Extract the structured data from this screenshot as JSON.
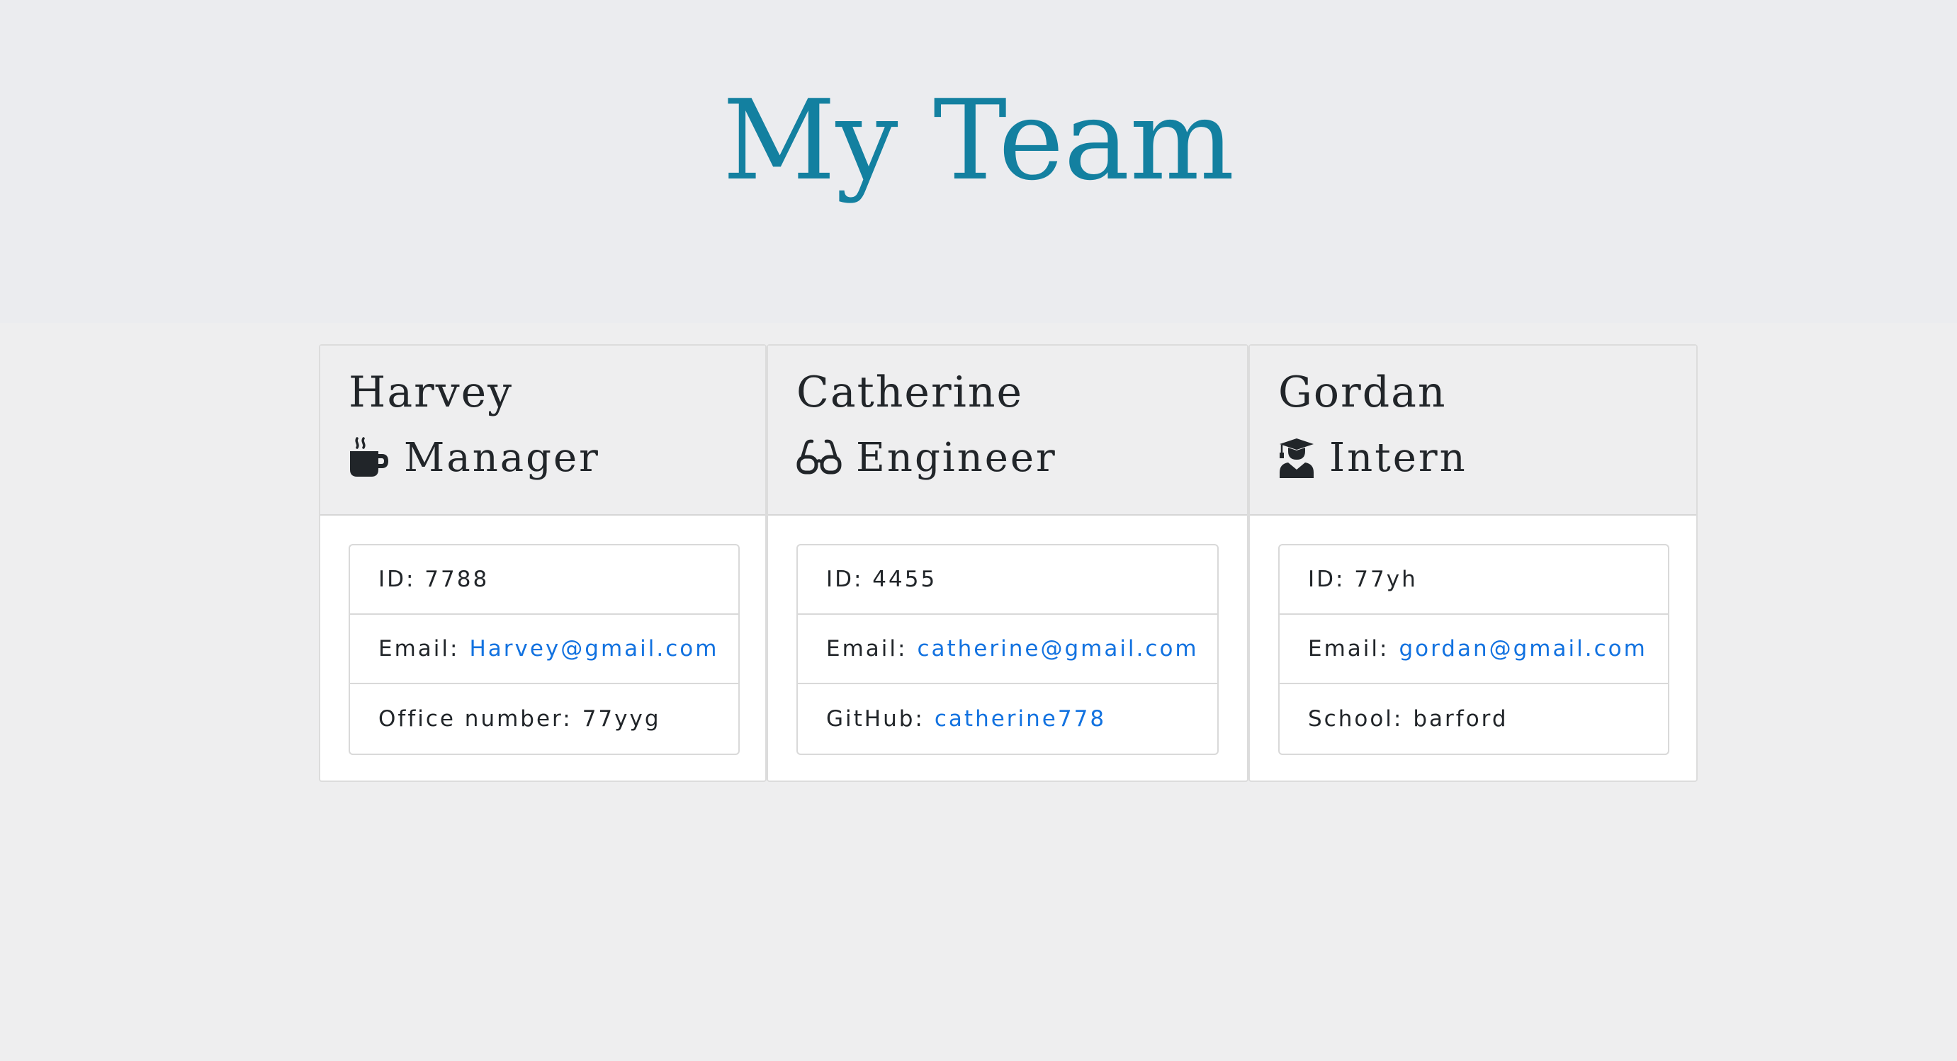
{
  "header": {
    "title": "My Team"
  },
  "employees": [
    {
      "name": "Harvey",
      "role": "Manager",
      "role_icon": "coffee-mug-icon",
      "id_text": "ID: 7788",
      "email_label": "Email:",
      "email": "Harvey@gmail.com",
      "extra_label": "Office number:",
      "extra_value": "77yyg"
    },
    {
      "name": "Catherine",
      "role": "Engineer",
      "role_icon": "glasses-icon",
      "id_text": "ID: 4455",
      "email_label": "Email:",
      "email": "catherine@gmail.com",
      "extra_label": "GitHub:",
      "extra_value": "catherine778"
    },
    {
      "name": "Gordan",
      "role": "Intern",
      "role_icon": "graduate-icon",
      "id_text": "ID: 77yh",
      "email_label": "Email:",
      "email": "gordan@gmail.com",
      "extra_label": "School:",
      "extra_value": "barford"
    }
  ],
  "colors": {
    "title": "#1380a0",
    "link": "#1272e0",
    "text": "#212529"
  }
}
